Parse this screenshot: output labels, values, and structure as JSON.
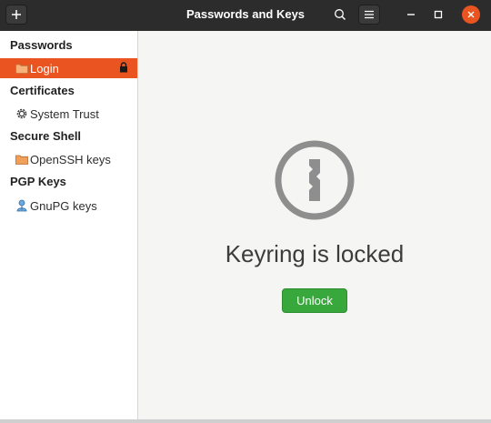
{
  "window": {
    "title": "Passwords and Keys"
  },
  "toolbar": {
    "add_icon": "plus-icon",
    "search_icon": "search-icon",
    "menu_icon": "hamburger-menu-icon"
  },
  "sidebar": {
    "sections": [
      {
        "heading": "Passwords",
        "items": [
          {
            "label": "Login",
            "icon": "folder-icon",
            "selected": true,
            "locked": true
          }
        ]
      },
      {
        "heading": "Certificates",
        "items": [
          {
            "label": "System Trust",
            "icon": "gear-icon"
          }
        ]
      },
      {
        "heading": "Secure Shell",
        "items": [
          {
            "label": "OpenSSH keys",
            "icon": "folder-icon"
          }
        ]
      },
      {
        "heading": "PGP Keys",
        "items": [
          {
            "label": "GnuPG keys",
            "icon": "person-key-icon"
          }
        ]
      }
    ]
  },
  "main": {
    "message": "Keyring is locked",
    "unlock_label": "Unlock",
    "lock_icon": "keyhole-lock-icon"
  },
  "colors": {
    "accent": "#e95420",
    "titlebar": "#2c2c2c",
    "unlock_button": "#38a83d",
    "main_bg": "#f5f5f4",
    "folder": "#f0a05a"
  }
}
